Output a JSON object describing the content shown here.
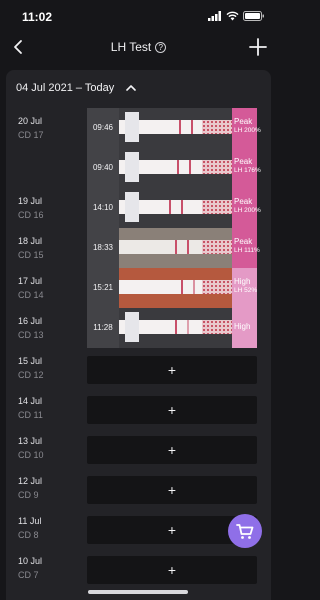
{
  "status_bar": {
    "time": "11:02"
  },
  "nav": {
    "title": "LH Test"
  },
  "range": {
    "label": "04 Jul 2021 – Today"
  },
  "colors": {
    "peak": "#d45a98",
    "high": "#e49ac6",
    "fab": "#8f6fe8"
  },
  "days": [
    {
      "date": "20 Jul",
      "cd": "CD 17"
    },
    {
      "date": "19 Jul",
      "cd": "CD 16"
    },
    {
      "date": "18 Jul",
      "cd": "CD 15"
    },
    {
      "date": "17 Jul",
      "cd": "CD 14"
    },
    {
      "date": "16 Jul",
      "cd": "CD 13"
    },
    {
      "date": "15 Jul",
      "cd": "CD 12"
    },
    {
      "date": "14 Jul",
      "cd": "CD 11"
    },
    {
      "date": "13 Jul",
      "cd": "CD 10"
    },
    {
      "date": "12 Jul",
      "cd": "CD 9"
    },
    {
      "date": "11 Jul",
      "cd": "CD 8"
    },
    {
      "date": "10 Jul",
      "cd": "CD 7"
    }
  ],
  "entries": [
    {
      "time": "09:46",
      "level": "Peak",
      "lh": "LH 200%"
    },
    {
      "time": "09:40",
      "level": "Peak",
      "lh": "LH 176%"
    },
    {
      "time": "14:10",
      "level": "Peak",
      "lh": "LH 200%"
    },
    {
      "time": "18:33",
      "level": "Peak",
      "lh": "LH 111%"
    },
    {
      "time": "15:21",
      "level": "High",
      "lh": "LH 52%"
    },
    {
      "time": "11:28",
      "level": "High",
      "lh": ""
    }
  ],
  "add_label": "+"
}
